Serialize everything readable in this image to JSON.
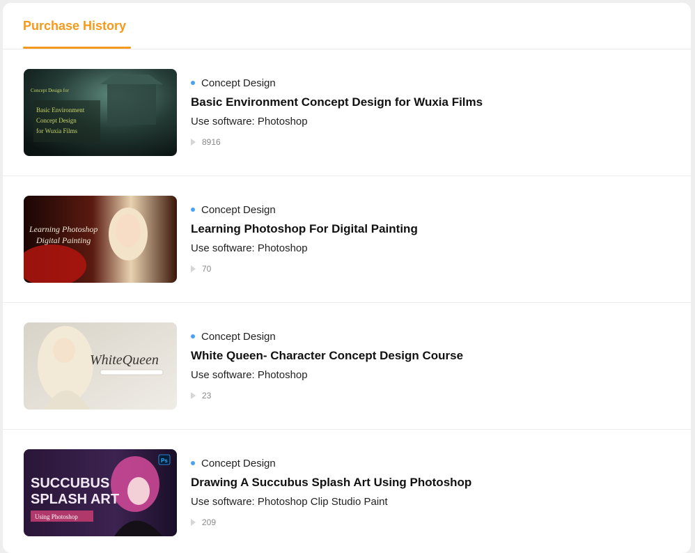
{
  "header": {
    "tab_label": "Purchase History"
  },
  "courses": [
    {
      "category": "Concept Design",
      "title": "Basic Environment Concept Design for Wuxia Films",
      "software": "Use software: Photoshop",
      "plays": "8916",
      "thumb_text": {
        "tag": "Concept Design for",
        "line1": "Basic Environment",
        "line2": "Concept Design",
        "line3": "for Wuxia Films"
      }
    },
    {
      "category": "Concept Design",
      "title": "Learning Photoshop For Digital Painting",
      "software": "Use software: Photoshop",
      "plays": "70",
      "thumb_text": {
        "line1": "Learning Photoshop",
        "line2": "Digital Painting"
      }
    },
    {
      "category": "Concept Design",
      "title": "White Queen- Character Concept Design Course",
      "software": "Use software: Photoshop",
      "plays": "23",
      "thumb_text": {
        "line1": "WhiteQueen"
      }
    },
    {
      "category": "Concept Design",
      "title": "Drawing A Succubus Splash Art Using Photoshop",
      "software": "Use software: Photoshop Clip Studio Paint",
      "plays": "209",
      "thumb_text": {
        "line1": "SUCCUBUS",
        "line2": "SPLASH ART",
        "line3": "Using Photoshop",
        "badge": "Ps"
      }
    }
  ]
}
